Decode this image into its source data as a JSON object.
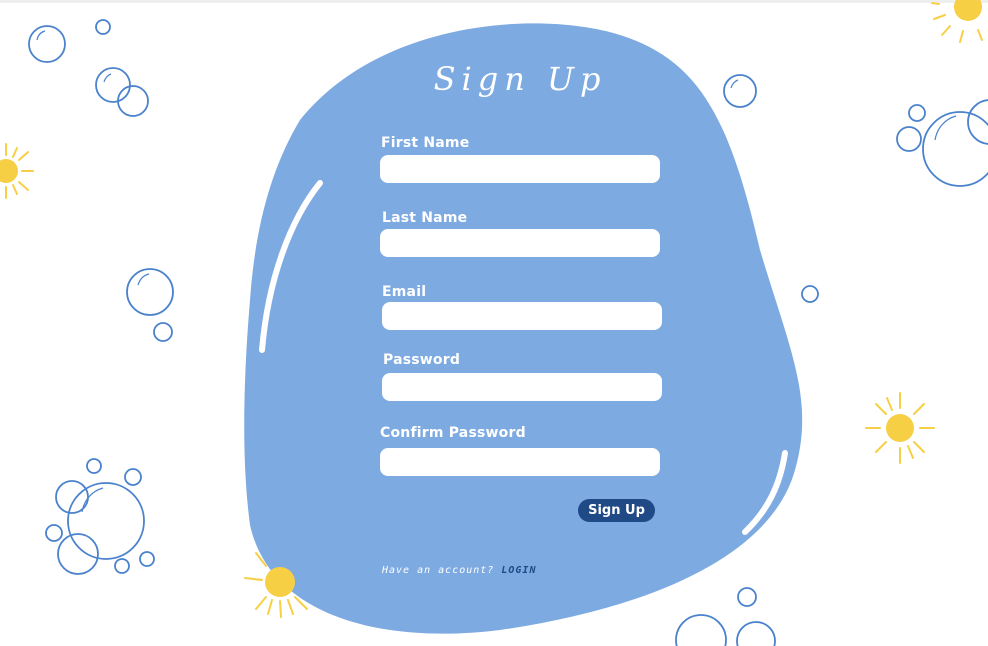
{
  "form": {
    "title": "Sign Up",
    "fields": [
      {
        "label": "First Name",
        "value": "",
        "placeholder": ""
      },
      {
        "label": "Last Name",
        "value": "",
        "placeholder": ""
      },
      {
        "label": "Email",
        "value": "",
        "placeholder": ""
      },
      {
        "label": "Password",
        "value": "",
        "placeholder": ""
      },
      {
        "label": "Confirm Password",
        "value": "",
        "placeholder": ""
      }
    ],
    "submit_label": "Sign Up"
  },
  "footer": {
    "text": "Have an account?",
    "link_label": "LOGIN"
  },
  "colors": {
    "card": "#7eaae2",
    "button": "#1f4a86",
    "bubble": "#4a82cc",
    "sun": "#f7cf45",
    "background": "#ffffff"
  },
  "decorations": {
    "bubble_icon": "bubble-icon",
    "sun_icon": "sun-icon"
  }
}
